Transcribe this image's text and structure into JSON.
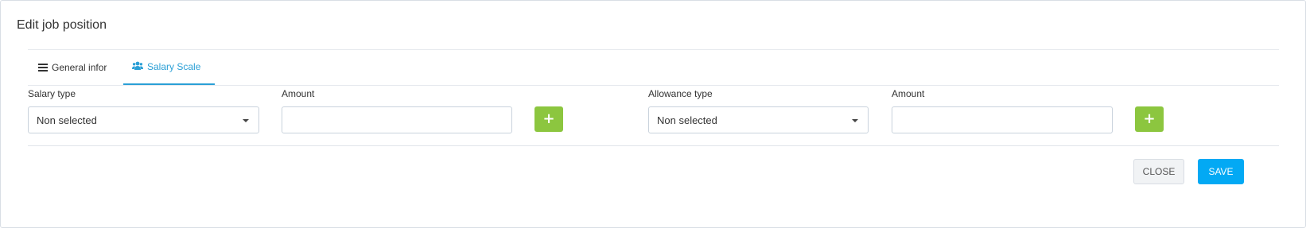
{
  "dialog": {
    "title": "Edit job position"
  },
  "tabs": [
    {
      "label": "General infor",
      "icon": "list-icon",
      "active": false
    },
    {
      "label": "Salary Scale",
      "icon": "users-icon",
      "active": true
    }
  ],
  "salary": {
    "type_label": "Salary type",
    "type_value": "Non selected",
    "amount_label": "Amount",
    "amount_value": "",
    "add_icon": "plus-icon"
  },
  "allowance": {
    "type_label": "Allowance type",
    "type_value": "Non selected",
    "amount_label": "Amount",
    "amount_value": "",
    "add_icon": "plus-icon"
  },
  "footer": {
    "close_label": "CLOSE",
    "save_label": "SAVE"
  },
  "colors": {
    "accent_blue": "#2a9fd6",
    "save_button": "#03a9f4",
    "add_button": "#8cc63f",
    "close_button_bg": "#f1f3f5"
  }
}
